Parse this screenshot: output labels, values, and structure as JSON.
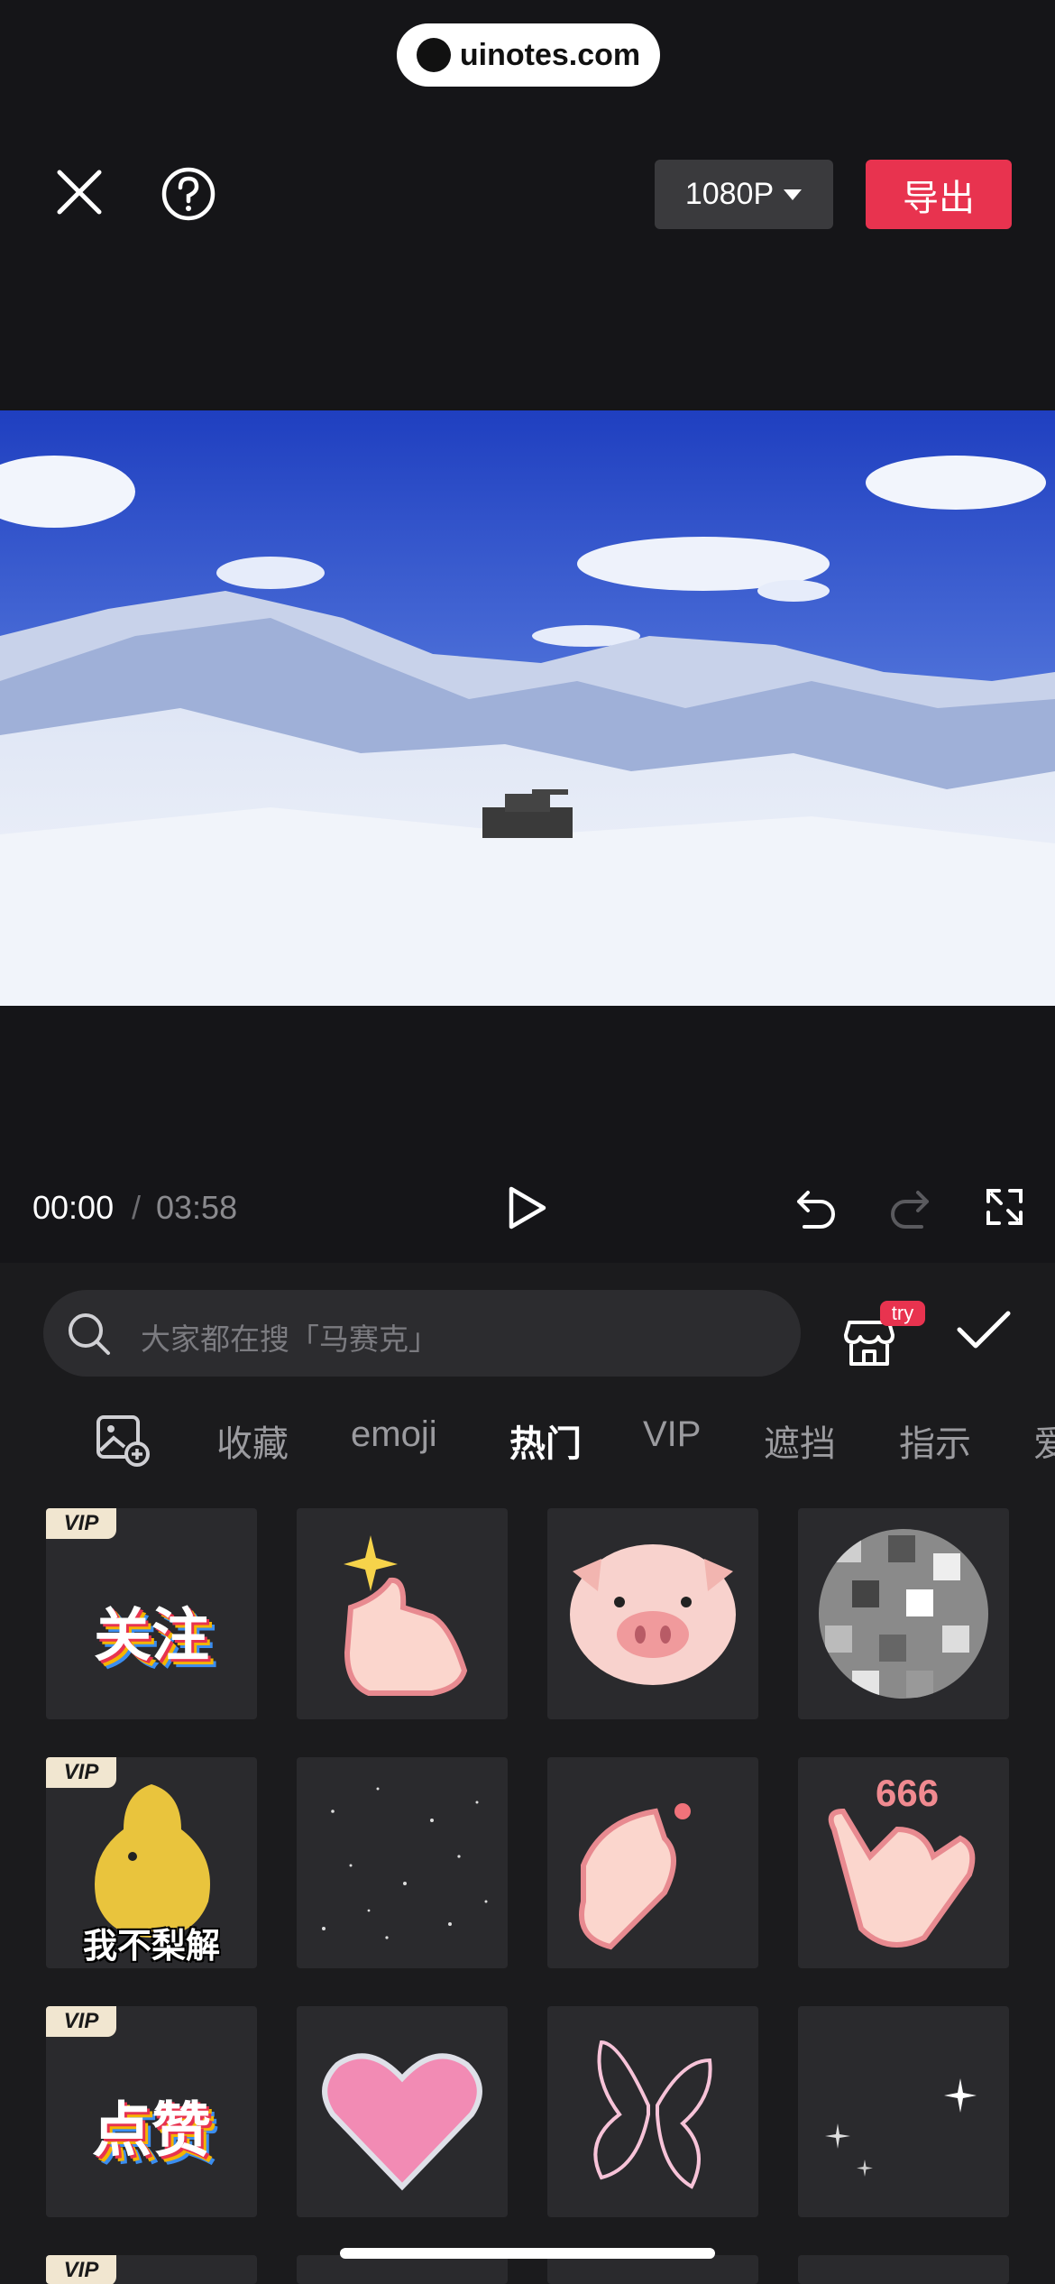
{
  "watermark": {
    "text": "uinotes.com"
  },
  "topbar": {
    "close_icon": "close-icon",
    "help_icon": "help-icon",
    "resolution": "1080P",
    "export_label": "导出"
  },
  "player": {
    "current_time": "00:00",
    "separator": "/",
    "total_time": "03:58"
  },
  "search": {
    "placeholder": "大家都在搜「马赛克」",
    "store_badge": "try"
  },
  "tabs": [
    {
      "label": "收藏",
      "active": false
    },
    {
      "label": "emoji",
      "active": false
    },
    {
      "label": "热门",
      "active": true
    },
    {
      "label": "VIP",
      "active": false
    },
    {
      "label": "遮挡",
      "active": false
    },
    {
      "label": "指示",
      "active": false
    },
    {
      "label": "爱",
      "active": false
    }
  ],
  "stickers": [
    {
      "name": "follow-sticker",
      "vip": true,
      "caption": "关注"
    },
    {
      "name": "thumbs-up-sticker",
      "vip": false
    },
    {
      "name": "pig-face-sticker",
      "vip": false
    },
    {
      "name": "mosaic-sticker",
      "vip": false
    },
    {
      "name": "pear-sticker",
      "vip": true,
      "caption": "我不梨解"
    },
    {
      "name": "stars-sticker",
      "vip": false
    },
    {
      "name": "finger-heart-sticker",
      "vip": false
    },
    {
      "name": "hand-666-sticker",
      "vip": false,
      "caption": "666"
    },
    {
      "name": "like-sticker",
      "vip": true,
      "caption": "点赞"
    },
    {
      "name": "heart-sticker",
      "vip": false
    },
    {
      "name": "butterfly-sticker",
      "vip": false
    },
    {
      "name": "sparkle-sticker",
      "vip": false
    }
  ],
  "vip_badge": "VIP"
}
